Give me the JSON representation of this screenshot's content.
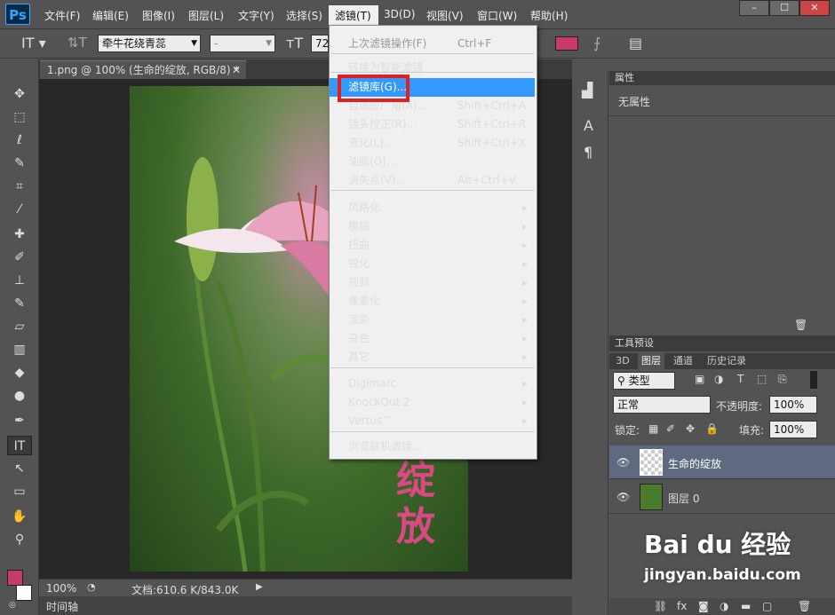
{
  "menubar": {
    "logo": "Ps",
    "items": [
      "文件(F)",
      "编辑(E)",
      "图像(I)",
      "图层(L)",
      "文字(Y)",
      "选择(S)",
      "滤镜(T)",
      "3D(D)",
      "视图(V)",
      "窗口(W)",
      "帮助(H)"
    ]
  },
  "window_buttons": [
    "–",
    "☐",
    "✕"
  ],
  "options_bar": {
    "font_family": "牵牛花绕青蕊",
    "font_style": "-",
    "font_size": "72"
  },
  "document": {
    "tab_title": "1.png @ 100% (生命的绽放, RGB/8) *",
    "canvas_text": [
      "绽",
      "放"
    ]
  },
  "status": {
    "zoom": "100%",
    "doc_info": "文档:610.6 K/843.0K",
    "timeline": "时间轴"
  },
  "filter_menu": {
    "items": [
      {
        "label": "上次滤镜操作(F)",
        "shortcut": "Ctrl+F",
        "disabled": true
      },
      {
        "label": "转换为智能滤镜",
        "shortcut": ""
      },
      {
        "label": "滤镜库(G)...",
        "shortcut": "",
        "highlighted": true
      },
      {
        "label": "自适应广角(A)...",
        "shortcut": "Shift+Ctrl+A"
      },
      {
        "label": "镜头校正(R)...",
        "shortcut": "Shift+Ctrl+R"
      },
      {
        "label": "液化(L)...",
        "shortcut": "Shift+Ctrl+X"
      },
      {
        "label": "油画(O)...",
        "shortcut": ""
      },
      {
        "label": "消失点(V)...",
        "shortcut": "Alt+Ctrl+V"
      },
      {
        "label": "风格化",
        "submenu": true
      },
      {
        "label": "模糊",
        "submenu": true
      },
      {
        "label": "扭曲",
        "submenu": true
      },
      {
        "label": "锐化",
        "submenu": true
      },
      {
        "label": "视频",
        "submenu": true
      },
      {
        "label": "像素化",
        "submenu": true
      },
      {
        "label": "渲染",
        "submenu": true
      },
      {
        "label": "杂色",
        "submenu": true
      },
      {
        "label": "其它",
        "submenu": true
      },
      {
        "label": "Digimarc",
        "submenu": true
      },
      {
        "label": "KnockOut 2",
        "submenu": true
      },
      {
        "label": "Vertus™",
        "submenu": true
      },
      {
        "label": "浏览联机滤镜...",
        "shortcut": ""
      }
    ]
  },
  "properties_panel": {
    "title": "属性",
    "content": "无属性"
  },
  "tool_presets": {
    "title": "工具预设"
  },
  "layers_panel": {
    "tabs": [
      "3D",
      "图层",
      "通道",
      "历史记录"
    ],
    "filter_kind": "类型",
    "blend_mode": "正常",
    "opacity_label": "不透明度:",
    "opacity": "100%",
    "lock_label": "锁定:",
    "fill_label": "填充:",
    "fill": "100%",
    "layers": [
      {
        "name": "生命的绽放",
        "selected": true
      },
      {
        "name": "图层 0",
        "selected": false
      }
    ]
  },
  "watermark": {
    "brand": "Bai du 经验",
    "url": "jingyan.baidu.com"
  },
  "colors": {
    "foreground": "#c83a6a",
    "background": "#ffffff",
    "menu_highlight": "#3399ff",
    "annotation_red": "#e02020"
  }
}
